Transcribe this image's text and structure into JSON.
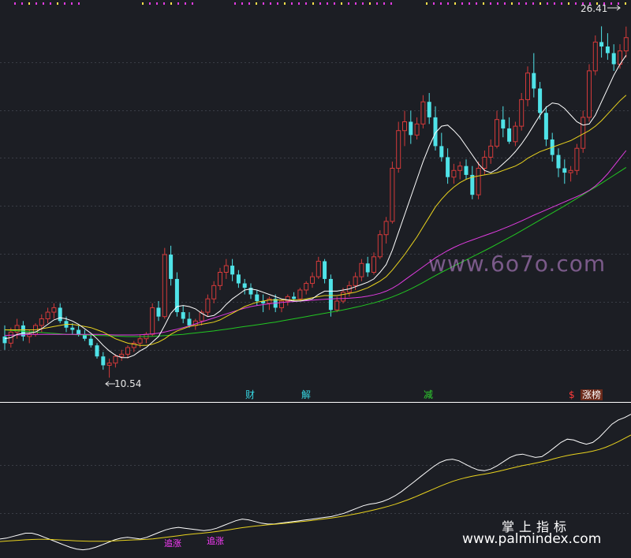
{
  "chart_data": [
    {
      "type": "candlestick",
      "title": "",
      "price_labels": {
        "high": "26.41",
        "low": "10.54"
      },
      "colors": {
        "up": "#d43a3a",
        "down": "#4fe3e8",
        "ma_short": "#ffffff",
        "ma_mid": "#e8d21e",
        "ma_long": "#e03ce0",
        "ma_trend": "#22c722",
        "grid": "#3a3d46"
      },
      "candles": [
        [
          12.4,
          12.9,
          11.8,
          12.1
        ],
        [
          12.1,
          12.8,
          11.9,
          12.6
        ],
        [
          12.6,
          13.2,
          12.3,
          12.9
        ],
        [
          12.9,
          13.1,
          12.2,
          12.4
        ],
        [
          12.4,
          12.7,
          12.1,
          12.5
        ],
        [
          12.5,
          13.0,
          12.4,
          12.9
        ],
        [
          12.9,
          13.4,
          12.6,
          13.2
        ],
        [
          13.2,
          13.7,
          13.0,
          13.5
        ],
        [
          13.5,
          13.9,
          13.2,
          13.7
        ],
        [
          13.7,
          13.9,
          13.0,
          13.1
        ],
        [
          13.1,
          13.3,
          12.6,
          12.8
        ],
        [
          12.8,
          13.0,
          12.5,
          12.7
        ],
        [
          12.7,
          12.9,
          12.4,
          12.5
        ],
        [
          12.5,
          12.7,
          12.2,
          12.3
        ],
        [
          12.3,
          12.5,
          11.9,
          12.0
        ],
        [
          12.0,
          12.1,
          11.4,
          11.5
        ],
        [
          11.5,
          11.7,
          10.9,
          11.1
        ],
        [
          11.1,
          11.4,
          10.54,
          11.2
        ],
        [
          11.2,
          11.6,
          11.0,
          11.5
        ],
        [
          11.5,
          11.8,
          11.3,
          11.6
        ],
        [
          11.6,
          12.0,
          11.4,
          11.9
        ],
        [
          11.9,
          12.2,
          11.7,
          12.1
        ],
        [
          12.1,
          12.5,
          11.9,
          12.3
        ],
        [
          12.3,
          12.6,
          12.1,
          12.5
        ],
        [
          12.5,
          13.9,
          12.4,
          13.7
        ],
        [
          13.7,
          14.0,
          13.1,
          13.3
        ],
        [
          13.3,
          16.4,
          13.2,
          16.1
        ],
        [
          16.1,
          16.5,
          14.7,
          15.0
        ],
        [
          15.0,
          15.3,
          13.3,
          13.5
        ],
        [
          13.5,
          13.8,
          13.0,
          13.2
        ],
        [
          13.2,
          13.5,
          12.8,
          12.9
        ],
        [
          12.9,
          13.2,
          12.7,
          13.1
        ],
        [
          13.1,
          13.6,
          12.9,
          13.5
        ],
        [
          13.5,
          14.3,
          13.3,
          14.1
        ],
        [
          14.1,
          14.9,
          13.9,
          14.7
        ],
        [
          14.7,
          15.5,
          14.5,
          15.3
        ],
        [
          15.3,
          15.9,
          15.0,
          15.6
        ],
        [
          15.6,
          15.9,
          14.9,
          15.2
        ],
        [
          15.2,
          15.4,
          14.6,
          14.8
        ],
        [
          14.8,
          15.0,
          14.3,
          14.6
        ],
        [
          14.6,
          14.8,
          14.1,
          14.3
        ],
        [
          14.3,
          14.5,
          13.8,
          14.0
        ],
        [
          14.0,
          14.3,
          13.5,
          13.9
        ],
        [
          13.9,
          14.2,
          13.6,
          14.1
        ],
        [
          14.1,
          14.3,
          13.5,
          13.7
        ],
        [
          13.7,
          14.1,
          13.5,
          14.0
        ],
        [
          14.0,
          14.3,
          13.8,
          14.2
        ],
        [
          14.2,
          14.4,
          14.0,
          14.1
        ],
        [
          14.1,
          14.6,
          14.0,
          14.5
        ],
        [
          14.5,
          14.9,
          14.3,
          14.8
        ],
        [
          14.8,
          15.3,
          14.6,
          15.1
        ],
        [
          15.1,
          16.0,
          15.0,
          15.8
        ],
        [
          15.8,
          15.9,
          14.8,
          15.0
        ],
        [
          15.0,
          15.2,
          13.3,
          13.6
        ],
        [
          13.6,
          14.2,
          13.5,
          14.0
        ],
        [
          14.0,
          14.6,
          13.9,
          14.4
        ],
        [
          14.4,
          14.9,
          14.2,
          14.7
        ],
        [
          14.7,
          15.3,
          14.5,
          15.1
        ],
        [
          15.1,
          15.9,
          14.9,
          15.7
        ],
        [
          15.7,
          16.0,
          15.1,
          15.3
        ],
        [
          15.3,
          16.2,
          15.2,
          16.0
        ],
        [
          16.0,
          17.2,
          15.9,
          17.0
        ],
        [
          17.0,
          17.8,
          16.6,
          17.6
        ],
        [
          17.6,
          20.3,
          17.5,
          20.0
        ],
        [
          20.0,
          22.1,
          19.8,
          21.7
        ],
        [
          21.7,
          22.6,
          21.0,
          22.1
        ],
        [
          22.1,
          22.6,
          21.1,
          21.5
        ],
        [
          21.5,
          22.3,
          21.3,
          22.0
        ],
        [
          22.0,
          23.3,
          21.8,
          23.0
        ],
        [
          23.0,
          23.4,
          22.0,
          22.3
        ],
        [
          22.3,
          22.8,
          20.8,
          21.0
        ],
        [
          21.0,
          21.6,
          20.3,
          20.5
        ],
        [
          20.5,
          20.9,
          19.3,
          19.6
        ],
        [
          19.6,
          20.2,
          19.3,
          19.9
        ],
        [
          19.9,
          20.3,
          19.5,
          20.1
        ],
        [
          20.1,
          20.4,
          19.5,
          19.7
        ],
        [
          19.7,
          20.1,
          18.6,
          18.8
        ],
        [
          18.8,
          20.3,
          18.6,
          20.0
        ],
        [
          20.0,
          20.8,
          19.7,
          20.5
        ],
        [
          20.5,
          21.3,
          20.2,
          21.0
        ],
        [
          21.0,
          22.6,
          20.9,
          22.2
        ],
        [
          22.2,
          22.8,
          21.4,
          21.8
        ],
        [
          21.8,
          22.3,
          21.1,
          21.2
        ],
        [
          21.2,
          22.1,
          21.0,
          21.9
        ],
        [
          21.9,
          23.4,
          21.7,
          23.1
        ],
        [
          23.1,
          24.6,
          22.8,
          24.3
        ],
        [
          24.3,
          25.2,
          23.2,
          23.6
        ],
        [
          23.6,
          23.9,
          22.2,
          22.5
        ],
        [
          22.5,
          22.8,
          21.0,
          21.3
        ],
        [
          21.3,
          21.6,
          20.3,
          20.6
        ],
        [
          20.6,
          20.9,
          19.6,
          20.0
        ],
        [
          20.0,
          20.4,
          19.3,
          19.8
        ],
        [
          19.8,
          20.1,
          19.4,
          19.9
        ],
        [
          19.9,
          21.1,
          19.7,
          20.9
        ],
        [
          20.9,
          22.6,
          20.7,
          22.3
        ],
        [
          22.3,
          24.7,
          22.1,
          24.4
        ],
        [
          24.4,
          26.0,
          24.2,
          25.7
        ],
        [
          25.7,
          26.41,
          25.0,
          25.5
        ],
        [
          25.5,
          26.1,
          24.9,
          25.2
        ],
        [
          25.2,
          25.6,
          24.4,
          24.7
        ],
        [
          24.7,
          25.6,
          24.5,
          25.3
        ],
        [
          25.3,
          26.4,
          25.0,
          25.9
        ]
      ],
      "ma": {
        "ma_short": [
          12.3,
          12.35,
          12.5,
          12.55,
          12.55,
          12.6,
          12.75,
          12.95,
          13.15,
          13.25,
          13.2,
          13.1,
          12.95,
          12.75,
          12.55,
          12.3,
          12.0,
          11.75,
          11.55,
          11.45,
          11.45,
          11.55,
          11.75,
          11.9,
          12.15,
          12.4,
          12.9,
          13.45,
          13.75,
          13.8,
          13.75,
          13.65,
          13.45,
          13.3,
          13.35,
          13.55,
          13.85,
          14.1,
          14.3,
          14.5,
          14.55,
          14.5,
          14.4,
          14.3,
          14.2,
          14.1,
          14.05,
          14.0,
          14.0,
          14.05,
          14.1,
          14.3,
          14.45,
          14.45,
          14.45,
          14.5,
          14.55,
          14.65,
          14.75,
          14.85,
          15.0,
          15.3,
          15.65,
          16.3,
          17.1,
          17.9,
          18.7,
          19.5,
          20.3,
          21.0,
          21.6,
          21.9,
          21.95,
          21.7,
          21.4,
          21.0,
          20.6,
          20.2,
          19.9,
          19.8,
          19.95,
          20.2,
          20.45,
          20.75,
          21.1,
          21.5,
          21.95,
          22.4,
          22.75,
          22.95,
          22.9,
          22.7,
          22.4,
          22.1,
          21.95,
          22.0,
          22.4,
          23.0,
          23.6,
          24.2,
          24.7,
          25.1
        ],
        "ma_mid": [
          12.7,
          12.7,
          12.7,
          12.7,
          12.7,
          12.7,
          12.75,
          12.8,
          12.85,
          12.9,
          12.95,
          12.95,
          12.9,
          12.85,
          12.8,
          12.7,
          12.6,
          12.45,
          12.3,
          12.2,
          12.1,
          12.05,
          12.0,
          12.0,
          12.05,
          12.15,
          12.3,
          12.5,
          12.65,
          12.75,
          12.85,
          12.9,
          12.95,
          13.0,
          13.05,
          13.15,
          13.3,
          13.45,
          13.6,
          13.75,
          13.85,
          13.95,
          14.0,
          14.05,
          14.05,
          14.05,
          14.05,
          14.05,
          14.05,
          14.1,
          14.15,
          14.2,
          14.25,
          14.25,
          14.25,
          14.3,
          14.35,
          14.4,
          14.5,
          14.6,
          14.75,
          14.9,
          15.1,
          15.4,
          15.75,
          16.1,
          16.5,
          16.9,
          17.35,
          17.8,
          18.25,
          18.6,
          18.9,
          19.15,
          19.35,
          19.5,
          19.6,
          19.65,
          19.7,
          19.75,
          19.8,
          19.9,
          20.0,
          20.1,
          20.25,
          20.45,
          20.6,
          20.75,
          20.85,
          20.95,
          21.05,
          21.15,
          21.25,
          21.4,
          21.55,
          21.7,
          21.9,
          22.15,
          22.45,
          22.75,
          23.05,
          23.3
        ],
        "ma_long": [
          12.45,
          12.46,
          12.47,
          12.48,
          12.49,
          12.5,
          12.5,
          12.5,
          12.5,
          12.5,
          12.5,
          12.5,
          12.5,
          12.5,
          12.5,
          12.5,
          12.49,
          12.48,
          12.47,
          12.47,
          12.47,
          12.47,
          12.48,
          12.5,
          12.52,
          12.55,
          12.6,
          12.67,
          12.73,
          12.8,
          12.88,
          12.97,
          13.06,
          13.15,
          13.24,
          13.33,
          13.42,
          13.51,
          13.6,
          13.68,
          13.75,
          13.8,
          13.84,
          13.88,
          13.91,
          13.94,
          13.96,
          13.98,
          14.0,
          14.02,
          14.04,
          14.06,
          14.08,
          14.1,
          14.11,
          14.12,
          14.13,
          14.15,
          14.18,
          14.22,
          14.28,
          14.35,
          14.45,
          14.58,
          14.75,
          14.95,
          15.15,
          15.35,
          15.55,
          15.75,
          15.95,
          16.12,
          16.28,
          16.42,
          16.55,
          16.66,
          16.76,
          16.86,
          16.96,
          17.06,
          17.16,
          17.27,
          17.38,
          17.5,
          17.62,
          17.75,
          17.88,
          18.0,
          18.12,
          18.24,
          18.36,
          18.48,
          18.6,
          18.72,
          18.85,
          19.0,
          19.2,
          19.45,
          19.75,
          20.1,
          20.45,
          20.8
        ],
        "ma_trend": [
          12.7,
          12.68,
          12.66,
          12.64,
          12.62,
          12.6,
          12.58,
          12.56,
          12.54,
          12.52,
          12.5,
          12.49,
          12.48,
          12.47,
          12.46,
          12.45,
          12.44,
          12.43,
          12.42,
          12.41,
          12.4,
          12.4,
          12.4,
          12.4,
          12.41,
          12.42,
          12.44,
          12.46,
          12.48,
          12.5,
          12.53,
          12.56,
          12.59,
          12.62,
          12.65,
          12.69,
          12.73,
          12.77,
          12.81,
          12.85,
          12.89,
          12.93,
          12.97,
          13.01,
          13.05,
          13.1,
          13.15,
          13.2,
          13.25,
          13.3,
          13.35,
          13.4,
          13.45,
          13.5,
          13.55,
          13.6,
          13.66,
          13.72,
          13.78,
          13.85,
          13.92,
          14.0,
          14.09,
          14.19,
          14.3,
          14.42,
          14.55,
          14.69,
          14.84,
          15.0,
          15.15,
          15.3,
          15.44,
          15.58,
          15.72,
          15.86,
          16.0,
          16.14,
          16.28,
          16.42,
          16.57,
          16.72,
          16.87,
          17.02,
          17.18,
          17.34,
          17.5,
          17.66,
          17.82,
          17.98,
          18.14,
          18.3,
          18.47,
          18.64,
          18.81,
          18.98,
          19.15,
          19.32,
          19.5,
          19.68,
          19.86,
          20.04
        ]
      },
      "ylim": [
        9.8,
        27.6
      ],
      "event_labels": [
        "财",
        "解",
        "减",
        "$",
        "涨榜"
      ]
    },
    {
      "type": "line",
      "title": "",
      "series_colors": [
        "#ffffff",
        "#e8d21e"
      ],
      "series": [
        {
          "values": [
            20,
            21,
            23,
            25,
            27,
            27,
            25,
            22,
            19,
            16,
            13,
            10,
            8,
            7,
            8,
            10,
            13,
            16,
            19,
            21,
            22,
            21,
            20,
            22,
            25,
            28,
            31,
            33,
            34,
            33,
            32,
            31,
            30,
            31,
            33,
            36,
            39,
            42,
            44,
            43,
            41,
            39,
            38,
            38,
            39,
            40,
            41,
            42,
            43,
            44,
            45,
            46,
            47,
            49,
            51,
            54,
            57,
            60,
            62,
            63,
            65,
            68,
            72,
            77,
            83,
            89,
            95,
            101,
            107,
            112,
            115,
            116,
            114,
            110,
            106,
            103,
            102,
            104,
            108,
            113,
            118,
            121,
            122,
            120,
            118,
            119,
            124,
            130,
            136,
            140,
            139,
            136,
            134,
            136,
            142,
            150,
            158,
            163,
            166,
            170
          ]
        },
        {
          "values": [
            17,
            17.5,
            18,
            18.5,
            19,
            19.4,
            19.6,
            19.6,
            19.4,
            19,
            18.6,
            18.2,
            17.8,
            17.5,
            17.3,
            17.2,
            17.2,
            17.4,
            17.8,
            18.2,
            18.6,
            18.9,
            19.2,
            19.6,
            20.2,
            21,
            22,
            23,
            24,
            25,
            25.8,
            26.5,
            27.2,
            28,
            29,
            30,
            31.2,
            32.4,
            33.6,
            34.6,
            35.5,
            36.3,
            37,
            37.7,
            38.4,
            39.1,
            39.9,
            40.7,
            41.5,
            42.4,
            43.3,
            44.3,
            45.3,
            46.4,
            47.6,
            49,
            50.5,
            52.1,
            53.8,
            55.5,
            57.4,
            59.5,
            61.8,
            64.4,
            67.2,
            70.2,
            73.4,
            76.7,
            80,
            83.3,
            86.4,
            89.2,
            91.6,
            93.6,
            95.3,
            96.7,
            98,
            99.4,
            101,
            102.8,
            104.7,
            106.5,
            108.2,
            109.7,
            111.2,
            112.8,
            114.6,
            116.6,
            118.6,
            120.3,
            121.7,
            122.9,
            124.1,
            125.6,
            127.6,
            130.2,
            133.4,
            137,
            141,
            145
          ]
        }
      ],
      "annotations": [
        "追涨",
        "追涨"
      ],
      "ylim": [
        0,
        180
      ]
    }
  ],
  "watermarks": {
    "site1": "www.6o7o.com",
    "site2_title": "掌上指标",
    "site2_url": "www.palmindex.com"
  }
}
